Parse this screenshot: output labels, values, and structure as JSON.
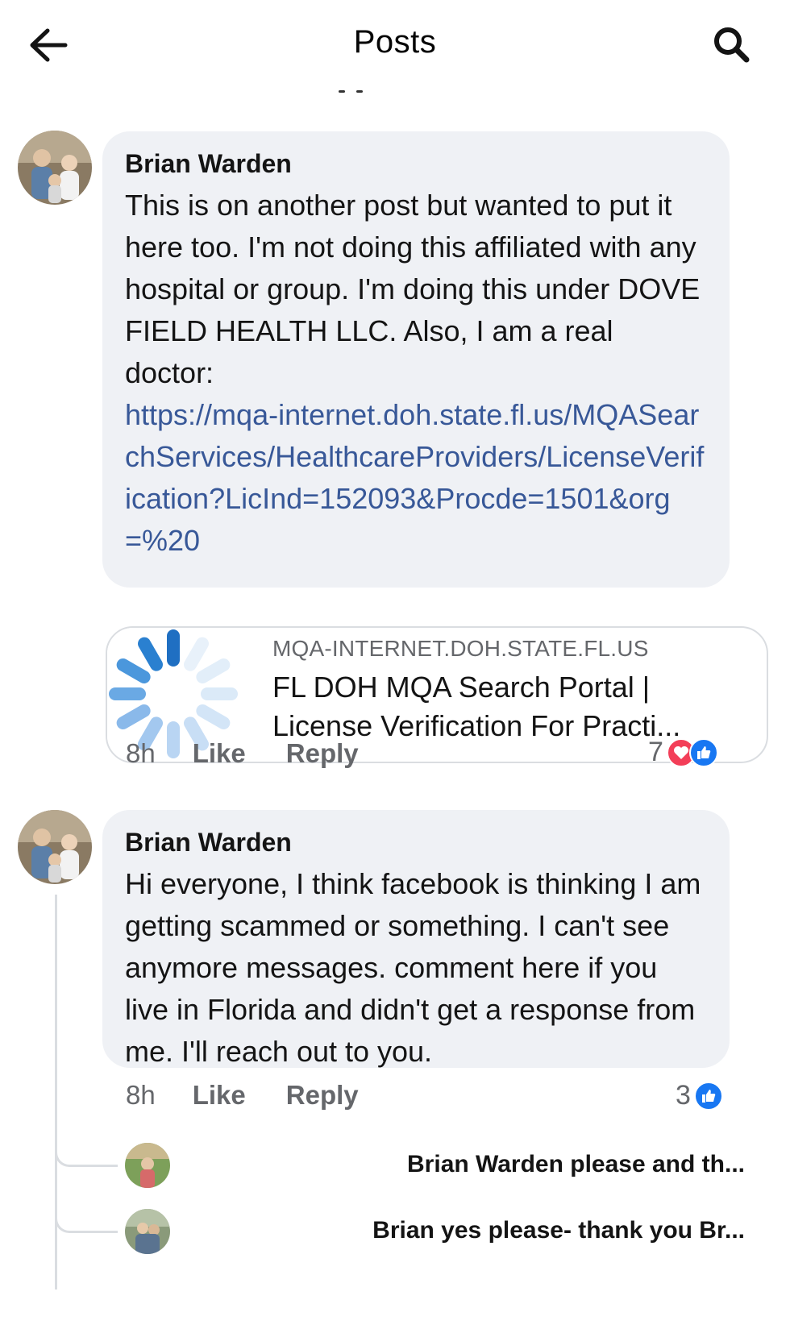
{
  "header": {
    "title": "Posts",
    "back_icon": "arrow-left-icon",
    "search_icon": "search-icon"
  },
  "comments": [
    {
      "author": "Brian Warden",
      "text": "This is on another post but wanted to put it here too. I'm not doing this affiliated with any hospital or group. I'm doing this under DOVE FIELD HEALTH LLC. Also, I am a real doctor:",
      "link": "https://mqa-internet.doh.state.fl.us/MQASearchServices/HealthcareProviders/LicenseVerification?LicInd=152093&Procde=1501&org=%20",
      "preview": {
        "domain": "MQA-INTERNET.DOH.STATE.FL.US",
        "title": "FL DOH MQA Search Portal | License Verification For Practi..."
      },
      "time": "8h",
      "like_label": "Like",
      "reply_label": "Reply",
      "reaction_count": "7",
      "reactions": [
        "heart-icon",
        "like-icon"
      ]
    },
    {
      "author": "Brian Warden",
      "text": "Hi everyone, I think facebook is thinking I am getting scammed or something.  I can't see anymore messages. comment here if you live in Florida and didn't get a response from me. I'll reach out to you.",
      "time": "8h",
      "like_label": "Like",
      "reply_label": "Reply",
      "reaction_count": "3",
      "reactions": [
        "like-icon"
      ]
    }
  ],
  "replies": [
    {
      "text": "Brian Warden please and th..."
    },
    {
      "text": "Brian yes please- thank you Br..."
    }
  ],
  "colors": {
    "bubble": "#eff1f5",
    "link": "#385898",
    "meta": "#65676b",
    "like": "#1877f2",
    "heart": "#f33e58"
  }
}
